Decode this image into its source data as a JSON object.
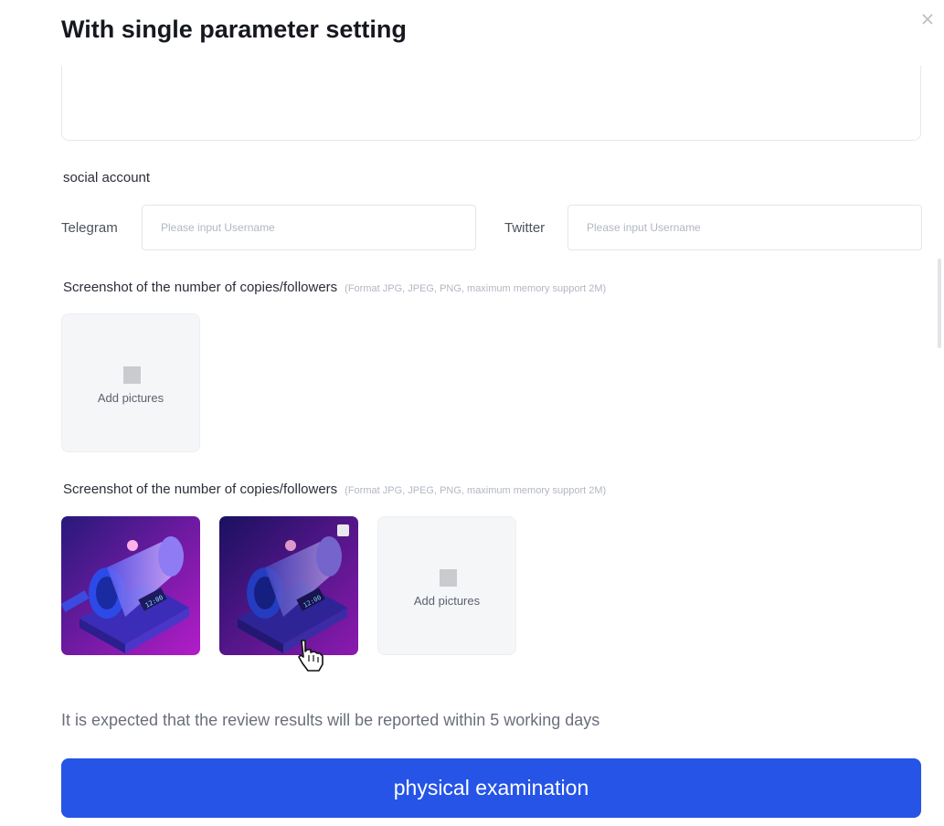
{
  "modal": {
    "title": "With single parameter setting",
    "close_icon": "close-icon"
  },
  "social": {
    "section_label": "social account",
    "telegram": {
      "label": "Telegram",
      "value": "",
      "placeholder": "Please input Username"
    },
    "twitter": {
      "label": "Twitter",
      "value": "",
      "placeholder": "Please input Username"
    }
  },
  "uploads": [
    {
      "label": "Screenshot of the number of copies/followers",
      "hint": "(Format JPG, JPEG, PNG, maximum memory support 2M)",
      "add_label": "Add pictures",
      "images": []
    },
    {
      "label": "Screenshot of the number of copies/followers",
      "hint": "(Format JPG, JPEG, PNG, maximum memory support 2M)",
      "add_label": "Add pictures",
      "images": [
        "isometric-time-machine-image",
        "isometric-time-machine-image"
      ]
    }
  ],
  "notice": "It is expected that the review results will be reported within 5 working days",
  "submit_label": "physical examination",
  "colors": {
    "primary": "#2554e6",
    "image_bg_top": "#2a1a7a",
    "image_bg_bottom": "#b21ac6"
  }
}
